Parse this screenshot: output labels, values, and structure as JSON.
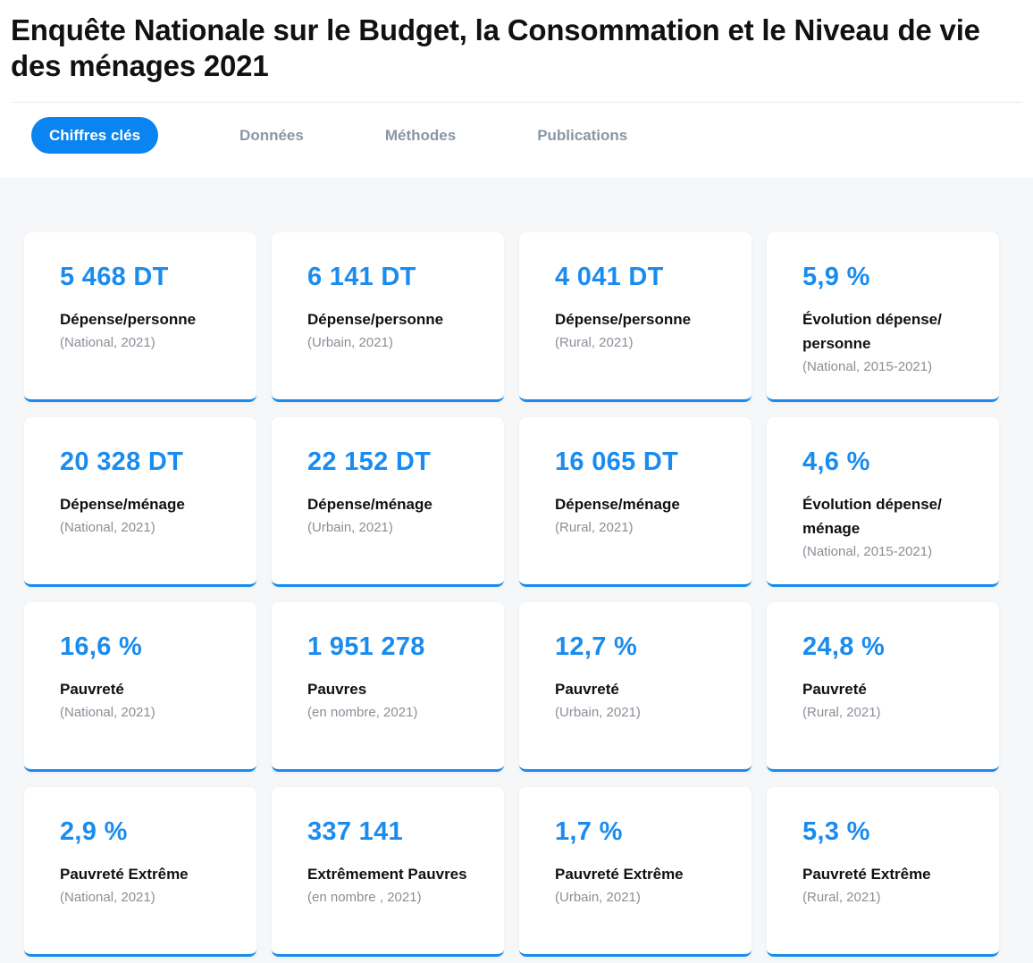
{
  "page": {
    "title": "Enquête Nationale sur le Budget, la Consommation et le Niveau de vie des ménages 2021"
  },
  "tabs": [
    {
      "label": "Chiffres clés",
      "active": true
    },
    {
      "label": "Données",
      "active": false
    },
    {
      "label": "Méthodes",
      "active": false
    },
    {
      "label": "Publications",
      "active": false
    }
  ],
  "colors": {
    "accent": "#0a84f0",
    "value": "#1a8cf0",
    "background": "#f6f7f9"
  },
  "cards": [
    {
      "value": "5 468 DT",
      "label": "Dépense/personne",
      "sub": "(National, 2021)"
    },
    {
      "value": "6 141 DT",
      "label": "Dépense/personne",
      "sub": "(Urbain, 2021)"
    },
    {
      "value": "4 041 DT",
      "label": "Dépense/personne",
      "sub": "(Rural, 2021)"
    },
    {
      "value": "5,9 %",
      "label": "Évolution dépense/ personne",
      "sub": "(National, 2015-2021)"
    },
    {
      "value": "20 328 DT",
      "label": "Dépense/ménage",
      "sub": "(National, 2021)"
    },
    {
      "value": "22 152 DT",
      "label": "Dépense/ménage",
      "sub": "(Urbain, 2021)"
    },
    {
      "value": "16 065 DT",
      "label": "Dépense/ménage",
      "sub": "(Rural, 2021)"
    },
    {
      "value": "4,6 %",
      "label": "Évolution dépense/ ménage",
      "sub": "(National, 2015-2021)"
    },
    {
      "value": "16,6 %",
      "label": "Pauvreté",
      "sub": "(National, 2021)"
    },
    {
      "value": "1 951 278",
      "label": "Pauvres",
      "sub": "(en nombre, 2021)"
    },
    {
      "value": "12,7 %",
      "label": "Pauvreté",
      "sub": "(Urbain, 2021)"
    },
    {
      "value": "24,8 %",
      "label": "Pauvreté",
      "sub": "(Rural, 2021)"
    },
    {
      "value": "2,9 %",
      "label": "Pauvreté Extrême",
      "sub": "(National, 2021)"
    },
    {
      "value": "337 141",
      "label": "Extrêmement Pauvres",
      "sub": "(en nombre , 2021)"
    },
    {
      "value": "1,7 %",
      "label": "Pauvreté Extrême",
      "sub": "(Urbain, 2021)"
    },
    {
      "value": "5,3 %",
      "label": "Pauvreté Extrême",
      "sub": "(Rural, 2021)"
    }
  ]
}
